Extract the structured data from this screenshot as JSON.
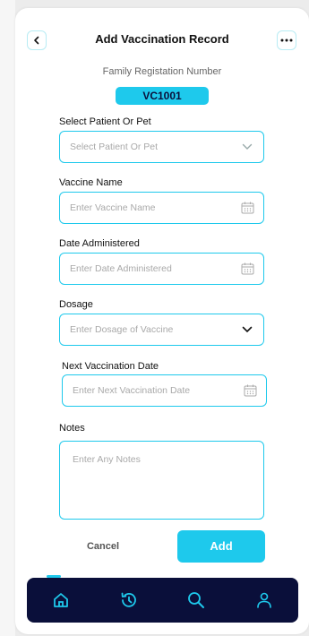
{
  "header": {
    "title": "Add Vaccination Record",
    "back_icon": "chevron-left-icon",
    "more_icon": "more-horizontal-icon"
  },
  "registration": {
    "label": "Family Registation Number",
    "number": "VC1001"
  },
  "form": {
    "patient": {
      "label": "Select  Patient Or Pet",
      "placeholder": "Select Patient Or Pet",
      "icon": "chevron-down-icon"
    },
    "vaccine_name": {
      "label": "Vaccine Name",
      "placeholder": "Enter  Vaccine Name",
      "icon": "calendar-icon"
    },
    "date_administered": {
      "label": "Date Administered",
      "placeholder": "Enter Date Administered",
      "icon": "calendar-icon"
    },
    "dosage": {
      "label": "Dosage",
      "placeholder": "Enter Dosage of Vaccine",
      "icon": "chevron-down-icon"
    },
    "next_date": {
      "label": "Next Vaccination Date",
      "placeholder": "Enter Next Vaccination Date",
      "icon": "calendar-icon"
    },
    "notes": {
      "label": "Notes",
      "placeholder": "Enter Any Notes"
    }
  },
  "actions": {
    "cancel_label": "Cancel",
    "add_label": "Add"
  },
  "nav": {
    "items": [
      {
        "icon": "home-icon",
        "active": true
      },
      {
        "icon": "history-icon",
        "active": false
      },
      {
        "icon": "search-icon",
        "active": false
      },
      {
        "icon": "profile-icon",
        "active": false
      }
    ]
  },
  "colors": {
    "accent": "#1ec9ec",
    "navbar": "#0a0f3a",
    "placeholder": "#a9a9a9"
  }
}
